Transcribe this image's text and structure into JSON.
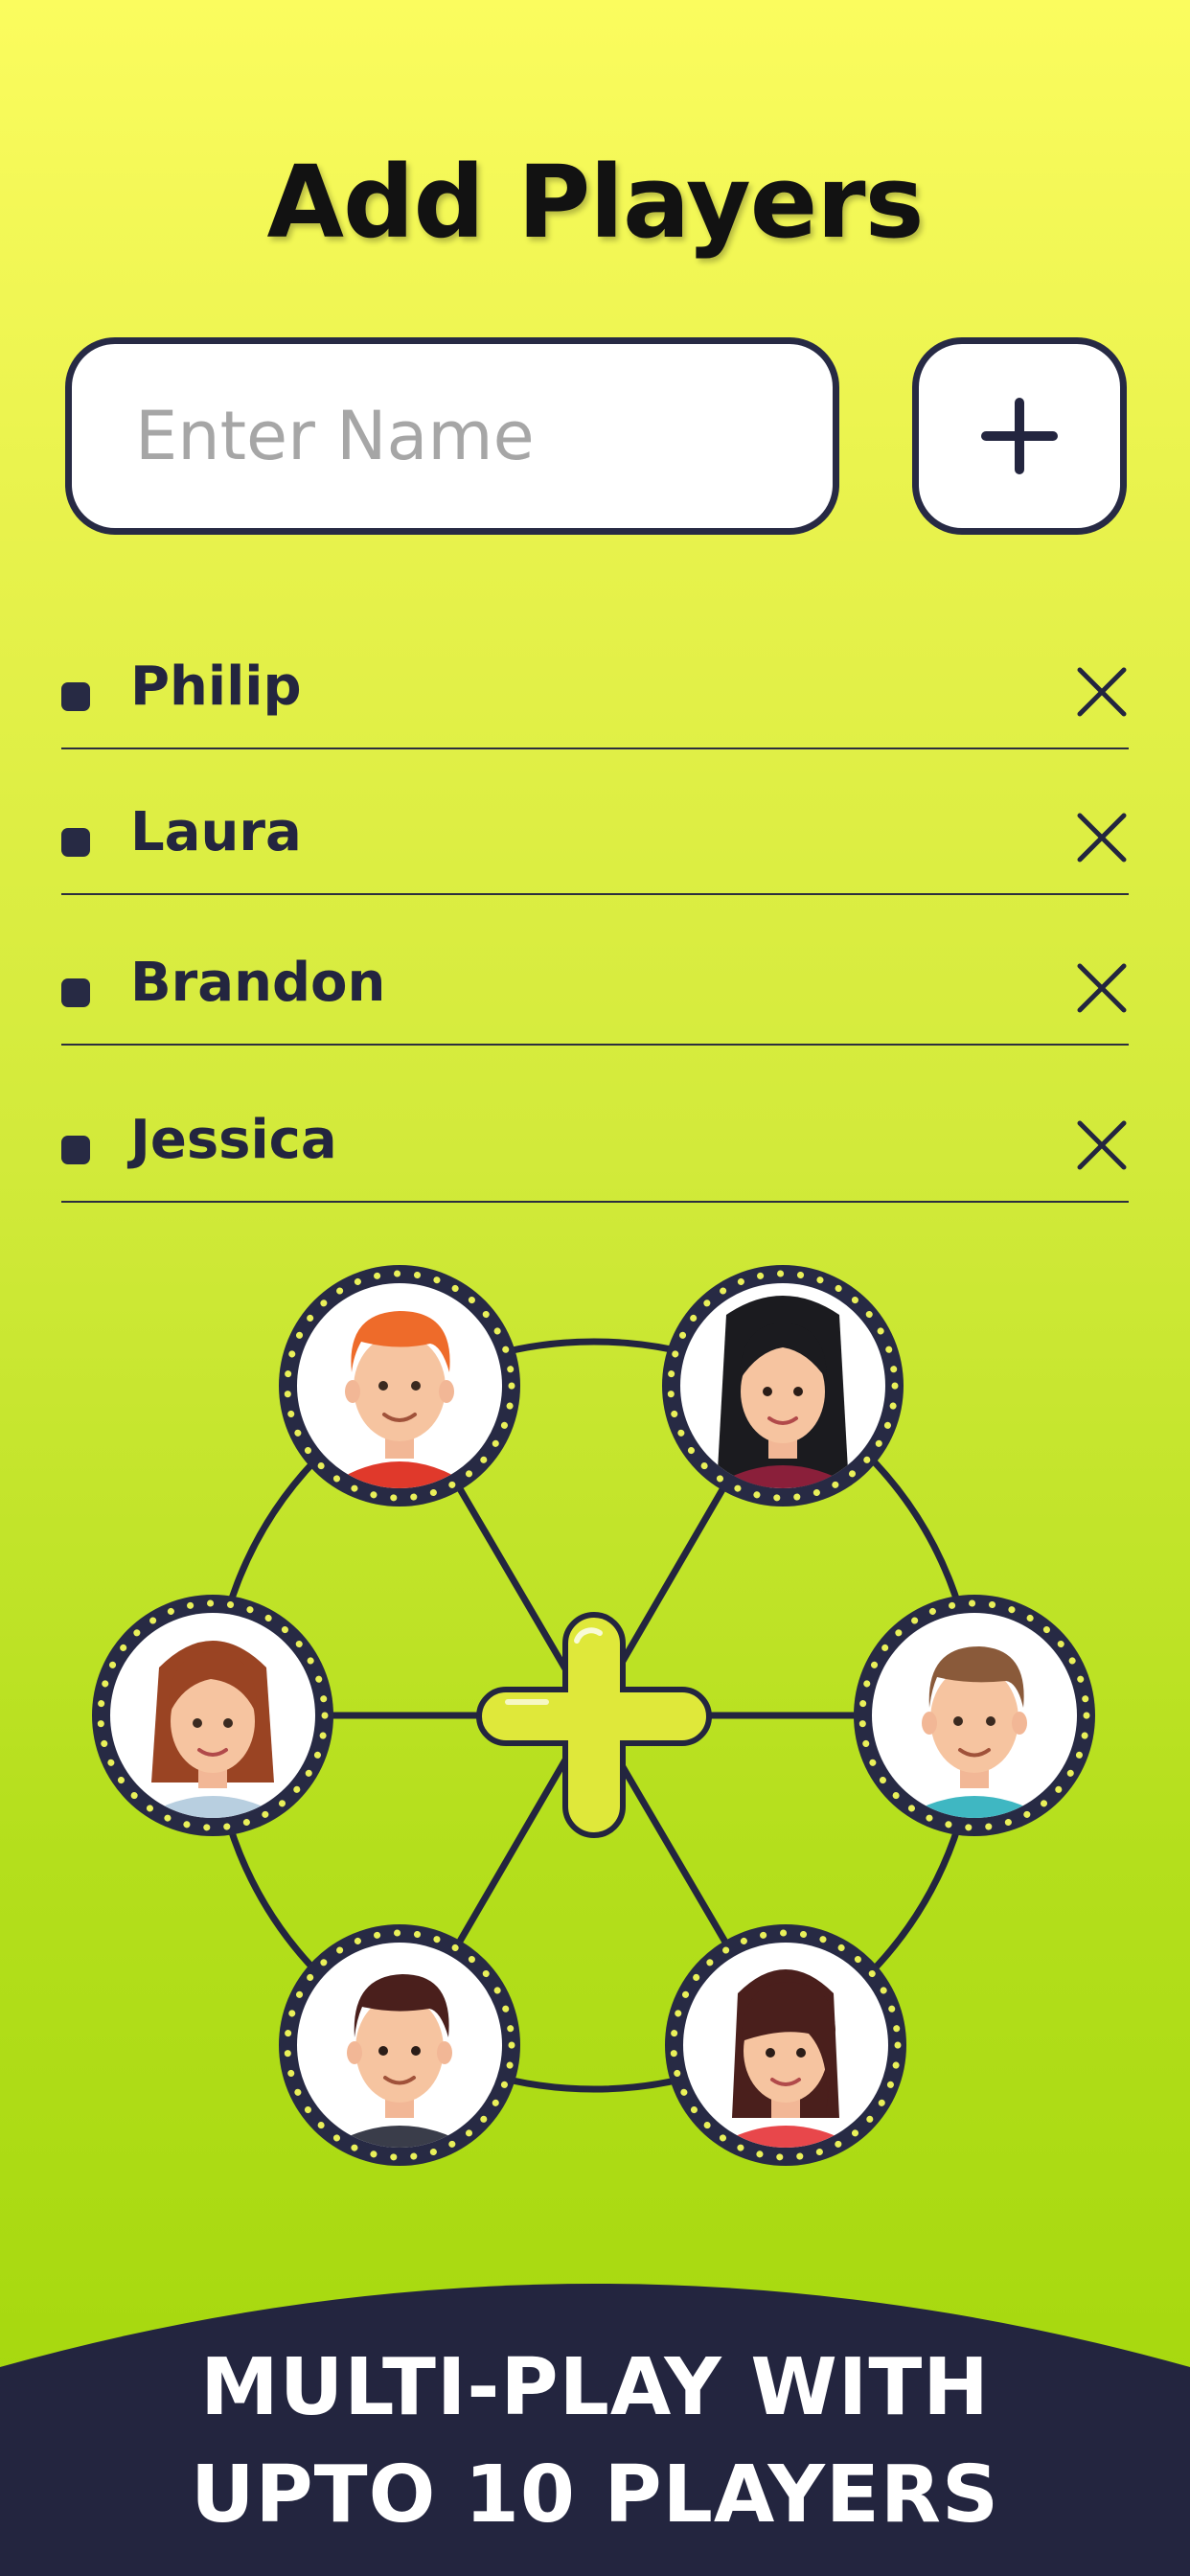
{
  "header": {
    "title": "Add Players"
  },
  "name_input": {
    "placeholder": "Enter Name",
    "value": ""
  },
  "add_button": {
    "icon": "plus-icon"
  },
  "players": [
    {
      "name": "Philip",
      "remove_icon": "close-icon"
    },
    {
      "name": "Laura",
      "remove_icon": "close-icon"
    },
    {
      "name": "Brandon",
      "remove_icon": "close-icon"
    },
    {
      "name": "Jessica",
      "remove_icon": "close-icon"
    }
  ],
  "illustration": {
    "center_icon": "plus-icon",
    "avatars": [
      "avatar-man-orange-hair",
      "avatar-woman-black-hair",
      "avatar-woman-auburn-hair",
      "avatar-man-brown-hair",
      "avatar-man-dark-hair",
      "avatar-woman-brown-hair"
    ]
  },
  "banner": {
    "line1": "MULTI-PLAY WITH",
    "line2": "UPTO 10 PLAYERS"
  },
  "colors": {
    "accent_dark": "#23253f",
    "lime_top": "#fbfc5e",
    "lime_bottom": "#a2d60a",
    "plus_fill": "#dfe83a"
  }
}
